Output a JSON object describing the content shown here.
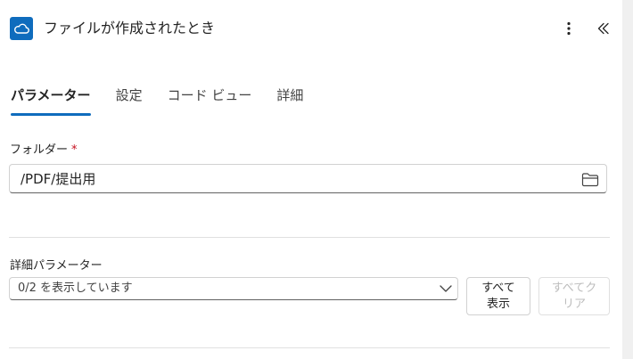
{
  "header": {
    "title": "ファイルが作成されたとき",
    "app_icon": "onedrive-cloud-icon",
    "more_icon": "more-vertical-icon",
    "collapse_icon": "double-chevron-left-icon",
    "accent_color": "#0f6cbd"
  },
  "tabs": [
    {
      "label": "パラメーター",
      "active": true
    },
    {
      "label": "設定",
      "active": false
    },
    {
      "label": "コード ビュー",
      "active": false
    },
    {
      "label": "詳細",
      "active": false
    }
  ],
  "folder": {
    "label": "フォルダー",
    "required_mark": "*",
    "value": "/PDF/提出用",
    "picker_icon": "folder-icon"
  },
  "advanced": {
    "label": "詳細パラメーター",
    "select_value": "0/2 を表示しています",
    "show_all_label": "すべて\n表示",
    "clear_all_label": "すべてク\nリア"
  }
}
